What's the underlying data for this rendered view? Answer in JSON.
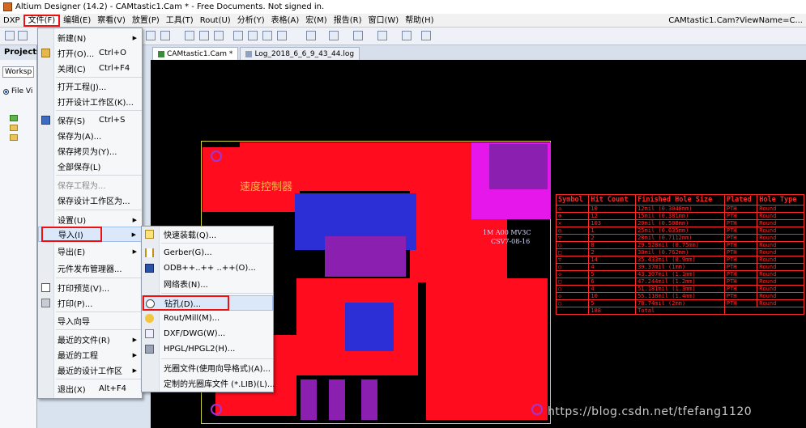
{
  "window": {
    "title": "Altium Designer (14.2) - CAMtastic1.Cam * - Free Documents. Not signed in."
  },
  "menubar": {
    "items": [
      "DXP",
      "文件(F)",
      "编辑(E)",
      "察看(V)",
      "放置(P)",
      "工具(T)",
      "Rout(U)",
      "分析(Y)",
      "表格(A)",
      "宏(M)",
      "报告(R)",
      "窗口(W)",
      "帮助(H)"
    ],
    "open_item": "文件(F)",
    "right_title": "CAMtastic1.Cam?ViewName=C..."
  },
  "left_panel": {
    "title": "Projects",
    "workspace_field": "Worksp",
    "radio_label": "File Vi"
  },
  "doc_tabs": [
    "CAMtastic1.Cam *",
    "Log_2018_6_6_9_43_44.log"
  ],
  "file_menu": {
    "items": [
      {
        "label": "新建(N)",
        "shortcut": "",
        "submenu": true,
        "icon": ""
      },
      {
        "label": "打开(O)...",
        "shortcut": "Ctrl+O",
        "submenu": false,
        "icon": "open-folder-icon"
      },
      {
        "label": "关闭(C)",
        "shortcut": "Ctrl+F4",
        "submenu": false,
        "icon": ""
      },
      {
        "label": "打开工程(J)...",
        "shortcut": "",
        "submenu": false,
        "icon": ""
      },
      {
        "label": "打开设计工作区(K)...",
        "shortcut": "",
        "submenu": false,
        "icon": ""
      },
      {
        "label": "保存(S)",
        "shortcut": "Ctrl+S",
        "submenu": false,
        "icon": "save-icon"
      },
      {
        "label": "保存为(A)...",
        "shortcut": "",
        "submenu": false,
        "icon": ""
      },
      {
        "label": "保存拷贝为(Y)...",
        "shortcut": "",
        "submenu": false,
        "icon": ""
      },
      {
        "label": "全部保存(L)",
        "shortcut": "",
        "submenu": false,
        "icon": ""
      },
      {
        "label": "保存工程为...",
        "shortcut": "",
        "submenu": false,
        "icon": "",
        "disabled": true
      },
      {
        "label": "保存设计工作区为...",
        "shortcut": "",
        "submenu": false,
        "icon": ""
      },
      {
        "label": "设置(U)",
        "shortcut": "",
        "submenu": true,
        "icon": ""
      },
      {
        "label": "导入(I)",
        "shortcut": "",
        "submenu": true,
        "icon": ""
      },
      {
        "label": "导出(E)",
        "shortcut": "",
        "submenu": true,
        "icon": ""
      },
      {
        "label": "元件发布管理器...",
        "shortcut": "",
        "submenu": false,
        "icon": ""
      },
      {
        "label": "打印预览(V)...",
        "shortcut": "",
        "submenu": false,
        "icon": "print-preview-icon"
      },
      {
        "label": "打印(P)...",
        "shortcut": "",
        "submenu": false,
        "icon": "printer-icon"
      },
      {
        "label": "导入向导",
        "shortcut": "",
        "submenu": false,
        "icon": ""
      },
      {
        "label": "最近的文件(R)",
        "shortcut": "",
        "submenu": true,
        "icon": ""
      },
      {
        "label": "最近的工程",
        "shortcut": "",
        "submenu": true,
        "icon": ""
      },
      {
        "label": "最近的设计工作区",
        "shortcut": "",
        "submenu": true,
        "icon": ""
      },
      {
        "label": "退出(X)",
        "shortcut": "Alt+F4",
        "submenu": false,
        "icon": ""
      }
    ],
    "highlighted": "导入(I)"
  },
  "import_submenu": {
    "items": [
      {
        "label": "快速装载(Q)...",
        "icon": "quick-load-icon"
      },
      {
        "label": "Gerber(G)...",
        "icon": "gerber-icon"
      },
      {
        "label": "ODB++..++ ..++(O)...",
        "icon": "odb-icon"
      },
      {
        "label": "网络表(N)...",
        "icon": ""
      },
      {
        "label": "钻孔(D)...",
        "icon": "drill-icon"
      },
      {
        "label": "Rout/Mill(M)...",
        "icon": "rout-mill-icon"
      },
      {
        "label": "DXF/DWG(W)...",
        "icon": "dxf-dwg-icon"
      },
      {
        "label": "HPGL/HPGL2(H)...",
        "icon": "hpgl-icon"
      },
      {
        "label": "光圈文件(使用向导格式)(A)...",
        "icon": ""
      },
      {
        "label": "定制的光圈库文件 (*.LIB)(L)...",
        "icon": ""
      }
    ],
    "highlighted": "钻孔(D)..."
  },
  "pcb": {
    "board_text": "速度控制器",
    "labels": [
      "1M  A00  MV3C",
      "CSV7-08-16"
    ]
  },
  "drill_table": {
    "headers": [
      "Symbol",
      "Hit Count",
      "Finished Hole Size",
      "Plated",
      "Hole Type"
    ],
    "rows": [
      [
        "◇",
        "10",
        "12mil (0.3048mm)",
        "PTH",
        "Round"
      ],
      [
        "⊕",
        "12",
        "15mil (0.381mm)",
        "PTH",
        "Round"
      ],
      [
        "✕",
        "103",
        "20mil (0.508mm)",
        "PTH",
        "Round"
      ],
      [
        "◎",
        "1",
        "25mil (0.635mm)",
        "PTH",
        "Round"
      ],
      [
        "▽",
        "2",
        "28mil (0.7112mm)",
        "PTH",
        "Round"
      ],
      [
        "○",
        "8",
        "29.528mil (0.75mm)",
        "PTH",
        "Round"
      ],
      [
        "□",
        "2",
        "30mil (0.762mm)",
        "PTH",
        "Round"
      ],
      [
        "▽",
        "14",
        "35.433mil (0.9mm)",
        "PTH",
        "Round"
      ],
      [
        "○",
        "4",
        "39.37mil (1mm)",
        "PTH",
        "Round"
      ],
      [
        "◇",
        "5",
        "43.307mil (1.1mm)",
        "PTH",
        "Round"
      ],
      [
        "□",
        "6",
        "47.244mil (1.2mm)",
        "PTH",
        "Round"
      ],
      [
        "○",
        "4",
        "51.181mil (1.3mm)",
        "PTH",
        "Round"
      ],
      [
        "◇",
        "10",
        "55.118mil (1.4mm)",
        "PTH",
        "Round"
      ],
      [
        "○",
        "5",
        "78.74mil (2mm)",
        "PTH",
        "Round"
      ]
    ],
    "total_count": "188",
    "total_label": "Total"
  },
  "watermark": "https://blog.csdn.net/tfefang1120",
  "colors": {
    "menu_highlight_border": "#ee1111",
    "pcb_top_copper": "#ff0c1e",
    "pcb_bottom_copper": "#2d2fd6",
    "canvas_bg": "#000000"
  }
}
